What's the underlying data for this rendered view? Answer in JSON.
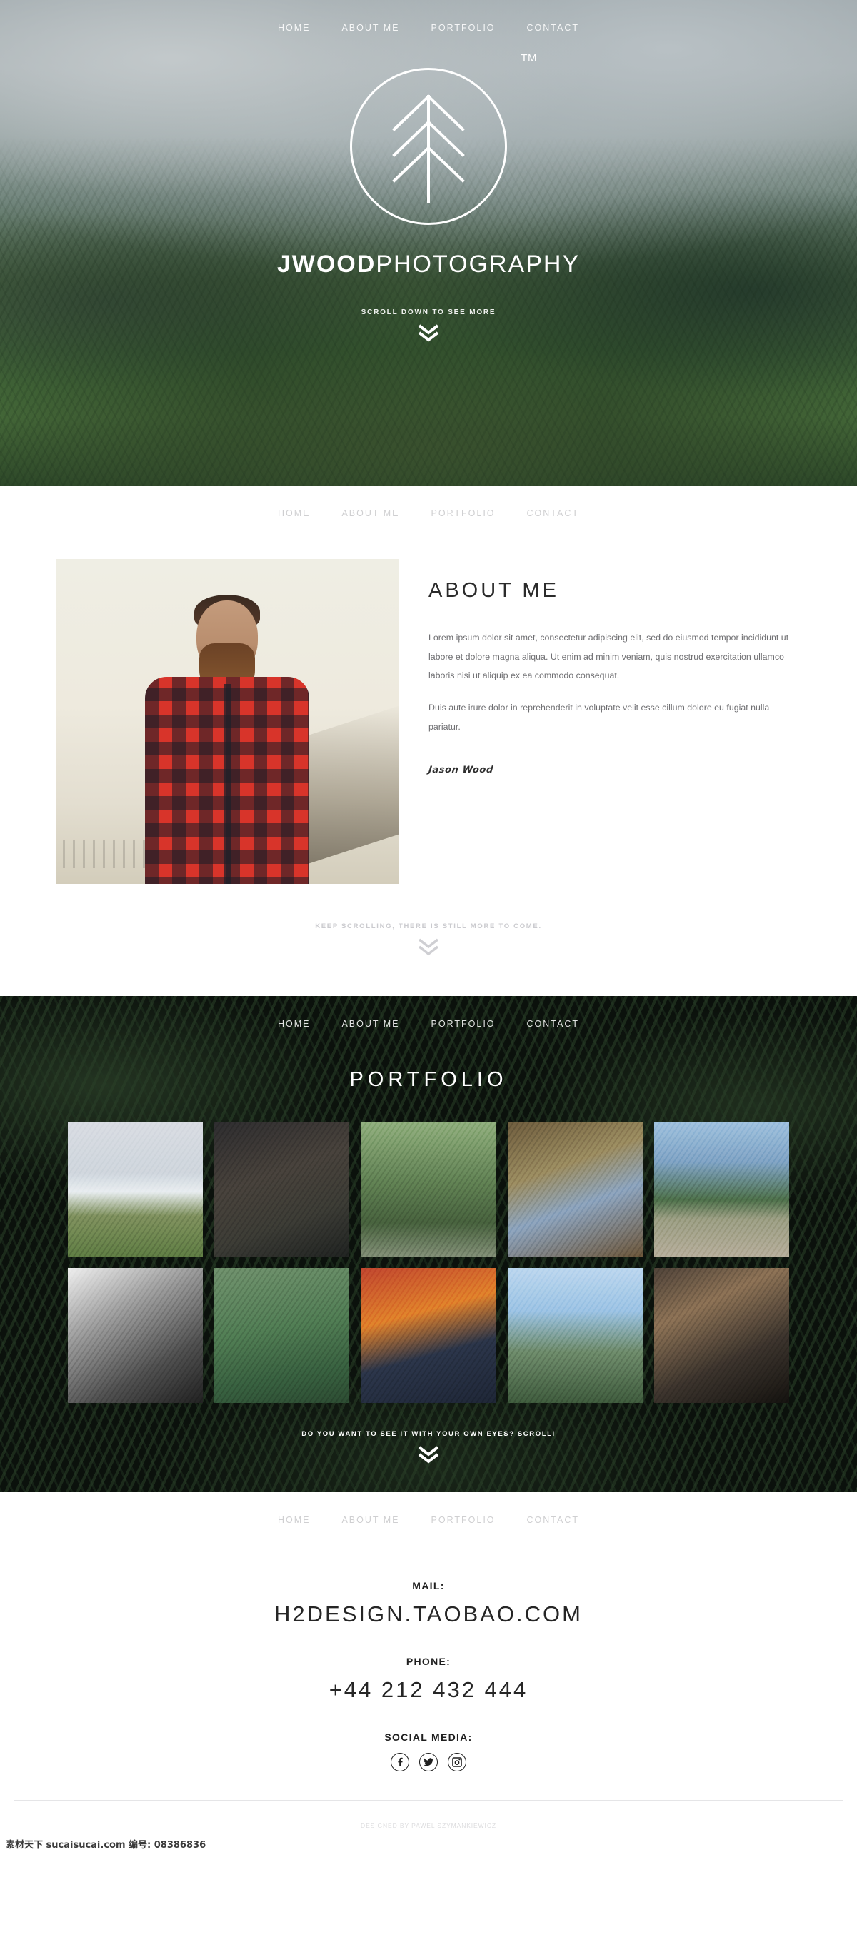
{
  "nav": {
    "items": [
      {
        "label": "HOME",
        "name": "nav-home"
      },
      {
        "label": "ABOUT ME",
        "name": "nav-about-me"
      },
      {
        "label": "PORTFOLIO",
        "name": "nav-portfolio"
      },
      {
        "label": "CONTACT",
        "name": "nav-contact"
      }
    ]
  },
  "hero": {
    "trademark": "TM",
    "brand_bold": "JWOOD",
    "brand_light": "PHOTOGRAPHY",
    "scroll_cue": "SCROLL DOWN TO SEE MORE",
    "logo_icon": "pine-tree-circle-logo",
    "chevron_icon": "double-chevron-down-icon"
  },
  "about": {
    "title": "ABOUT ME",
    "photo_alt": "bearded-man-red-plaid-shirt",
    "paragraphs": [
      "Lorem ipsum dolor sit amet, consectetur adipiscing elit, sed do eiusmod tempor incididunt ut labore et dolore magna aliqua. Ut enim ad minim veniam, quis nostrud exercitation ullamco laboris nisi ut aliquip ex ea commodo consequat.",
      "Duis aute irure dolor in reprehenderit in voluptate velit esse cillum dolore eu fugiat nulla pariatur."
    ],
    "signature": "Jason Wood",
    "scroll_cue": "KEEP SCROLLING, THERE IS STILL MORE TO COME."
  },
  "portfolio": {
    "title": "PORTFOLIO",
    "scroll_cue": "DO YOU WANT TO SEE IT WITH YOUR OWN EYES? SCROLLI",
    "items": [
      {
        "name": "portfolio-thumb-hills-clouds",
        "alt": "rolling green hills above cloud layer"
      },
      {
        "name": "portfolio-thumb-woman-hat",
        "alt": "woman in wide brim hat and sunglasses"
      },
      {
        "name": "portfolio-thumb-forest-bridge",
        "alt": "wooden footbridge through forest"
      },
      {
        "name": "portfolio-thumb-boots-sitting",
        "alt": "person tying boots in the woods"
      },
      {
        "name": "portfolio-thumb-mountain-lake-dock",
        "alt": "dock on alpine lake with mountains"
      },
      {
        "name": "portfolio-thumb-couple-bw",
        "alt": "black and white portrait of a couple"
      },
      {
        "name": "portfolio-thumb-succulents",
        "alt": "green succulent plants from above"
      },
      {
        "name": "portfolio-thumb-man-cap",
        "alt": "man in orange brim cap and red jacket"
      },
      {
        "name": "portfolio-thumb-mountains-forest",
        "alt": "forest slope with mountain peaks and clouds"
      },
      {
        "name": "portfolio-thumb-bearded-man",
        "alt": "profile portrait of bearded man"
      }
    ]
  },
  "contact": {
    "mail_label": "MAIL:",
    "mail_value": "H2DESIGN.TAOBAO.COM",
    "phone_label": "PHONE:",
    "phone_value": "+44 212 432 444",
    "social_label": "SOCIAL MEDIA:",
    "socials": [
      {
        "name": "facebook-icon",
        "glyph": "f"
      },
      {
        "name": "twitter-icon",
        "glyph": "t"
      },
      {
        "name": "instagram-icon",
        "glyph": "i"
      }
    ]
  },
  "footer": {
    "credit": "DESIGNED BY PAWEL SZYMANKIEWICZ",
    "watermark": "素材天下 sucaisucai.com  编号: 08386836"
  }
}
